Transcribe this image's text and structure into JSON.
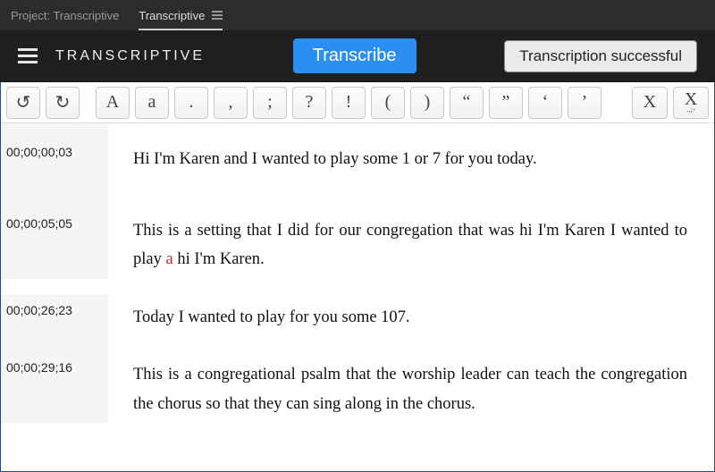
{
  "topbar": {
    "project_label": "Project: Transcriptive",
    "tab_label": "Transcriptive"
  },
  "header": {
    "app_title": "TRANSCRIPTIVE",
    "transcribe_label": "Transcribe",
    "status_label": "Transcription successful"
  },
  "toolbar": {
    "undo": "↺",
    "redo": "↻",
    "upper": "A",
    "lower": "a",
    "period": ".",
    "comma": ",",
    "semicolon": ";",
    "question": "?",
    "exclaim": "!",
    "lparen": "(",
    "rparen": ")",
    "ldquo": "“",
    "rdquo": "”",
    "lsquo": "‘",
    "rsquo": "’",
    "clear": "X",
    "clear_punct_top": "X",
    "clear_punct_sub": ".,;-"
  },
  "rows": [
    {
      "time": "00;00;00;03",
      "text_before": "Hi I'm Karen and I wanted to play some 1 or 7 for you today.",
      "flag": "",
      "text_after": ""
    },
    {
      "time": "00;00;05;05",
      "text_before": "This is a setting that I did for our congregation that was hi I'm Karen I wanted to play ",
      "flag": "a",
      "text_after": " hi I'm Karen."
    },
    {
      "time": "00;00;26;23",
      "text_before": "Today I wanted to play for you some 107.",
      "flag": "",
      "text_after": ""
    },
    {
      "time": "00;00;29;16",
      "text_before": "This is a congregational psalm that the worship leader can teach the congregation the chorus so that they can sing along in the chorus.",
      "flag": "",
      "text_after": ""
    }
  ]
}
